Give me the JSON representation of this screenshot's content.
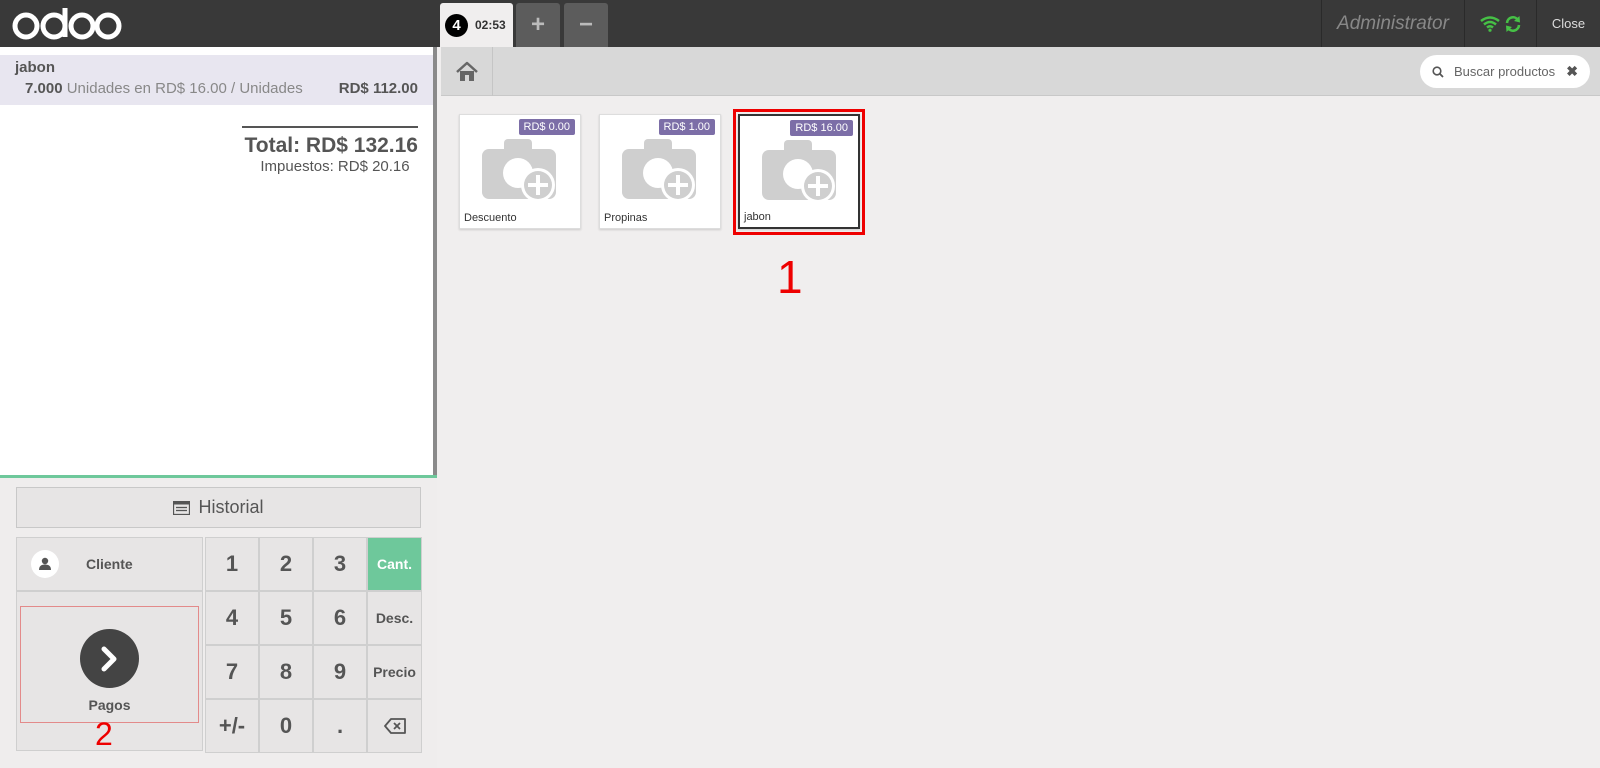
{
  "topbar": {
    "order_number": "4",
    "order_time": "02:53",
    "add_label": "+",
    "remove_label": "−",
    "user_name": "Administrator",
    "close_label": "Close"
  },
  "orderline": {
    "product": "jabon",
    "quantity": "7.000",
    "unit_desc": "Unidades en RD$ 16.00 / Unidades",
    "price": "RD$ 112.00"
  },
  "summary": {
    "total": "Total: RD$ 132.16",
    "taxes": "Impuestos: RD$ 20.16"
  },
  "controls": {
    "historial": "Historial",
    "cliente": "Cliente",
    "pagos": "Pagos",
    "annotation": "2"
  },
  "numpad": [
    "1",
    "2",
    "3",
    "Cant.",
    "4",
    "5",
    "6",
    "Desc.",
    "7",
    "8",
    "9",
    "Precio",
    "+/-",
    "0",
    ".",
    "⌫"
  ],
  "search": {
    "placeholder": "Buscar productos"
  },
  "products": [
    {
      "name": "Descuento",
      "price": "RD$ 0.00"
    },
    {
      "name": "Propinas",
      "price": "RD$ 1.00"
    },
    {
      "name": "jabon",
      "price": "RD$ 16.00"
    }
  ],
  "annotation_1": "1",
  "colors": {
    "accent": "#6ec89b",
    "price_badge": "#7c6ea7",
    "annotation": "#e00000"
  }
}
